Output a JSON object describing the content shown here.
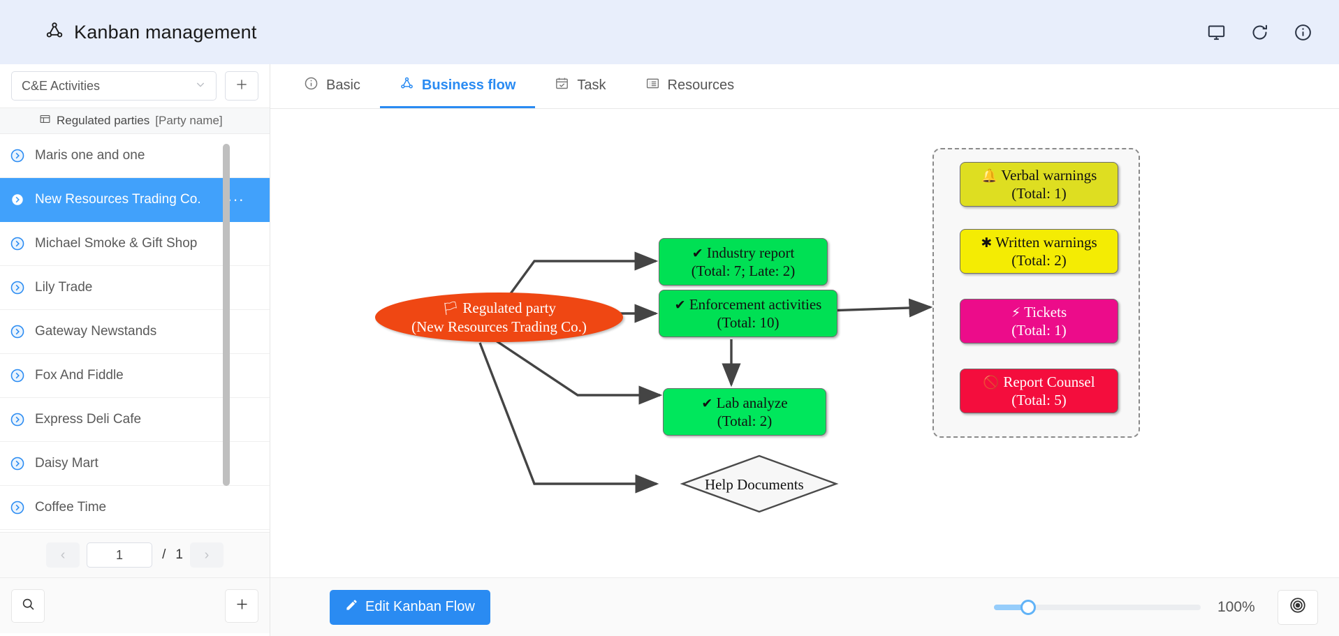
{
  "header": {
    "title": "Kanban management",
    "logo_icon": "share-nodes-icon",
    "icons": [
      {
        "name": "monitor-icon"
      },
      {
        "name": "refresh-icon"
      },
      {
        "name": "info-icon"
      }
    ]
  },
  "sidebar": {
    "selector": {
      "value": "C&E Activities",
      "chevron": "chevron-down-icon"
    },
    "add_label": "+",
    "column_header": {
      "icon": "table-icon",
      "title": "Regulated parties",
      "subtitle": "[Party name]"
    },
    "rows": [
      {
        "label": "Maris one and one",
        "selected": false
      },
      {
        "label": "New Resources Trading Co.",
        "selected": true,
        "menu": "···"
      },
      {
        "label": "Michael Smoke & Gift Shop",
        "selected": false
      },
      {
        "label": "Lily Trade",
        "selected": false
      },
      {
        "label": "Gateway Newstands",
        "selected": false
      },
      {
        "label": "Fox And Fiddle",
        "selected": false
      },
      {
        "label": "Express Deli Cafe",
        "selected": false
      },
      {
        "label": "Daisy Mart",
        "selected": false
      },
      {
        "label": "Coffee Time",
        "selected": false
      }
    ],
    "pager": {
      "prev": "‹",
      "page": "1",
      "separator": "/",
      "total": "1",
      "next": "›"
    },
    "footer": {
      "search_icon": "search-icon",
      "add_icon": "plus-icon"
    }
  },
  "main": {
    "tabs": [
      {
        "label": "Basic",
        "icon": "info-circle-icon",
        "active": false
      },
      {
        "label": "Business flow",
        "icon": "share-nodes-icon",
        "active": true
      },
      {
        "label": "Task",
        "icon": "calendar-check-icon",
        "active": false
      },
      {
        "label": "Resources",
        "icon": "list-icon",
        "active": false
      }
    ]
  },
  "flow": {
    "nodes": [
      {
        "id": "regulated-party",
        "shape": "ellipse",
        "line1": "Regulated party",
        "line2": "(New Resources Trading Co.)",
        "glyph": "🏳",
        "glyph_name": "flag-icon",
        "fill": "#ef4713",
        "text_color": "#ffffff"
      },
      {
        "id": "industry-report",
        "shape": "rect",
        "line1": "Industry report",
        "line2": "(Total: 7; Late: 2)",
        "glyph": "✔",
        "glyph_name": "check-icon",
        "fill": "#00e054",
        "text_color": "#111111"
      },
      {
        "id": "enforcement-activities",
        "shape": "rect",
        "line1": "Enforcement activities",
        "line2": "(Total: 10)",
        "glyph": "✔",
        "glyph_name": "check-icon",
        "fill": "#00e054",
        "text_color": "#111111"
      },
      {
        "id": "lab-analyze",
        "shape": "rect",
        "line1": "Lab analyze",
        "line2": "(Total: 2)",
        "glyph": "✔",
        "glyph_name": "check-icon",
        "fill": "#00e75c",
        "text_color": "#111111"
      },
      {
        "id": "verbal-warnings",
        "shape": "rect",
        "line1": "Verbal warnings",
        "line2": "(Total: 1)",
        "glyph": "🔔",
        "glyph_name": "bell-icon",
        "fill": "#dede21",
        "text_color": "#111111"
      },
      {
        "id": "written-warnings",
        "shape": "rect",
        "line1": "Written warnings",
        "line2": "(Total: 2)",
        "glyph": "✱",
        "glyph_name": "asterisk-icon",
        "fill": "#f4ec03",
        "text_color": "#111111"
      },
      {
        "id": "tickets",
        "shape": "rect",
        "line1": "Tickets",
        "line2": "(Total: 1)",
        "glyph": "⚡",
        "glyph_name": "bolt-icon",
        "fill": "#ec0c8a",
        "text_color": "#ffffff"
      },
      {
        "id": "report-counsel",
        "shape": "rect",
        "line1": "Report Counsel",
        "line2": "(Total: 5)",
        "glyph": "🚫",
        "glyph_name": "ban-icon",
        "fill": "#f40d3d",
        "text_color": "#ffffff"
      },
      {
        "id": "help-documents",
        "shape": "diamond",
        "line1": "Help Documents",
        "line2": "",
        "glyph": "",
        "glyph_name": "",
        "fill": "#f7f7f7",
        "text_color": "#111111"
      }
    ]
  },
  "bottom": {
    "edit_button": {
      "label": "Edit Kanban Flow",
      "icon": "pencil-icon"
    },
    "zoom": {
      "value": "100%",
      "slider_percent": 16
    },
    "focus_icon": "target-icon"
  }
}
